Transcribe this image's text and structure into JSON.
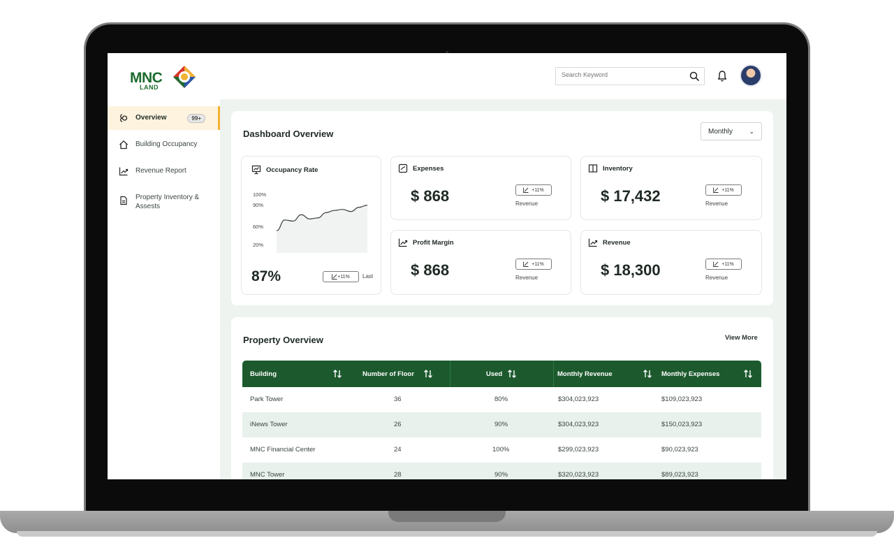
{
  "brand": {
    "logo_text": "MNC",
    "logo_sub": "LAND"
  },
  "header": {
    "search_placeholder": "Search Keyword"
  },
  "sidebar": {
    "items": [
      {
        "label": "Overview",
        "badge": "99+",
        "active": true
      },
      {
        "label": "Building Occupancy"
      },
      {
        "label": "Revenue Report"
      },
      {
        "label": "Property Inventory & Assests"
      }
    ]
  },
  "dashboard": {
    "title": "Dashboard Overview",
    "period_select": "Monthly",
    "occupancy": {
      "title": "Occupancy Rate",
      "value": "87%",
      "trend": "+11%",
      "trend_caption": "Last",
      "y_ticks": [
        "100%",
        "90%",
        "60%",
        "20%"
      ],
      "series": [
        0.42,
        0.62,
        0.6,
        0.72,
        0.64,
        0.66,
        0.76,
        0.8,
        0.82,
        0.78,
        0.86,
        0.9
      ]
    },
    "cards": [
      {
        "title": "Expenses",
        "value": "$ 868",
        "trend": "+11%",
        "caption": "Revenue",
        "icon": "chart-box-icon"
      },
      {
        "title": "Inventory",
        "value": "$ 17,432",
        "trend": "+11%",
        "caption": "Revenue",
        "icon": "book-icon"
      },
      {
        "title": "Profit Margin",
        "value": "$ 868",
        "trend": "+11%",
        "caption": "Revenue",
        "icon": "trend-up-icon"
      },
      {
        "title": "Revenue",
        "value": "$ 18,300",
        "trend": "+11%",
        "caption": "Revenue",
        "icon": "trend-up-icon"
      }
    ]
  },
  "property": {
    "title": "Property Overview",
    "view_more": "View More",
    "columns": [
      "Building",
      "Number of Floor",
      "Used",
      "Monthly Revenue",
      "Monthly Expenses"
    ],
    "rows": [
      [
        "Park Tower",
        "36",
        "80%",
        "$304,023,923",
        "$109,023,923"
      ],
      [
        "iNews Tower",
        "26",
        "90%",
        "$304,023,923",
        "$150,023,923"
      ],
      [
        "MNC Financial Center",
        "24",
        "100%",
        "$299,023,923",
        "$90,023,923"
      ],
      [
        "MNC Tower",
        "28",
        "90%",
        "$320,023,923",
        "$89,023,923"
      ]
    ]
  },
  "colors": {
    "brand_green": "#1c5a2e",
    "accent_yellow": "#f2b233",
    "background": "#eef3f0"
  }
}
